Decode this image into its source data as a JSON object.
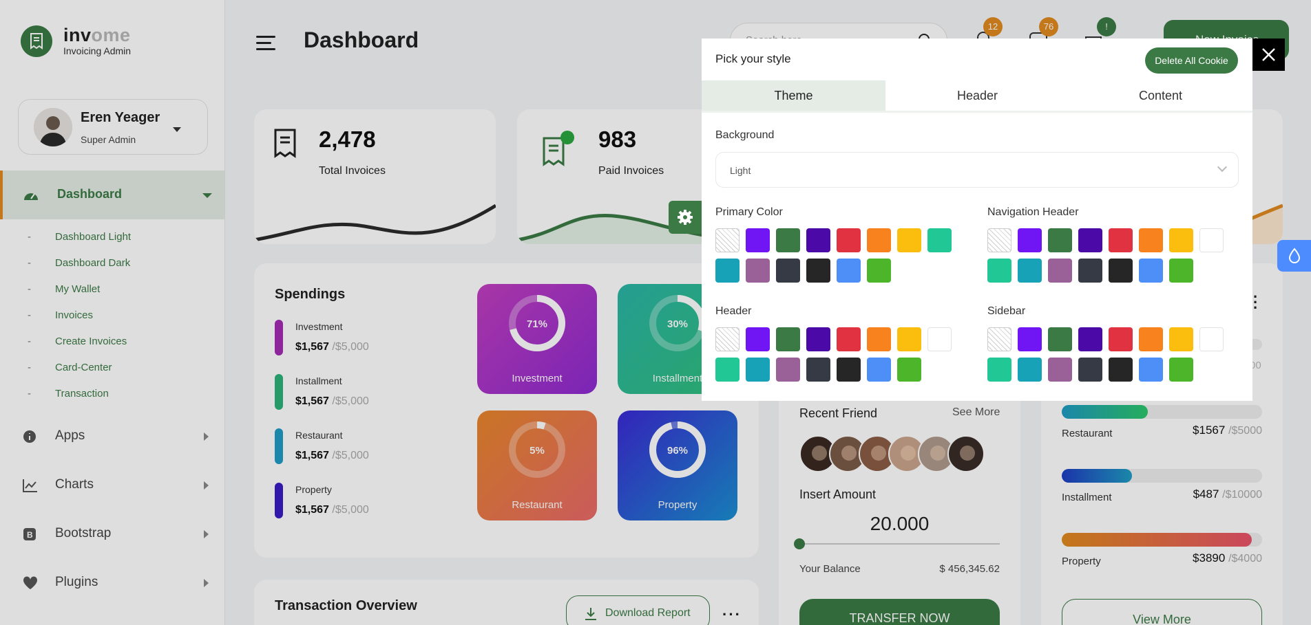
{
  "app": {
    "brand_dark": "inv",
    "brand_light": "ome",
    "subtitle": "Invoicing Admin"
  },
  "profile": {
    "name": "Eren Yeager",
    "role": "Super Admin"
  },
  "sidebar": {
    "active": "Dashboard",
    "sub_items": [
      "Dashboard Light",
      "Dashboard Dark",
      "My Wallet",
      "Invoices",
      "Create Invoices",
      "Card-Center",
      "Transaction"
    ],
    "items": [
      {
        "label": "Apps",
        "icon": "info-icon"
      },
      {
        "label": "Charts",
        "icon": "chart-icon"
      },
      {
        "label": "Bootstrap",
        "icon": "bootstrap-icon"
      },
      {
        "label": "Plugins",
        "icon": "heart-icon"
      }
    ]
  },
  "header": {
    "title": "Dashboard",
    "search_placeholder": "Search here...",
    "badges": [
      "12",
      "76",
      "!"
    ],
    "new_button": "New Invoice"
  },
  "stats": [
    {
      "value": "2,478",
      "label": "Total Invoices"
    },
    {
      "value": "983",
      "label": "Paid Invoices"
    }
  ],
  "spendings": {
    "title": "Spendings",
    "items": [
      {
        "name": "Investment",
        "value": "$1,567",
        "of": "/$5,000",
        "color": "#a42bb5"
      },
      {
        "name": "Installment",
        "value": "$1,567",
        "of": "/$5,000",
        "color": "#2cb37a"
      },
      {
        "name": "Restaurant",
        "value": "$1,567",
        "of": "/$5,000",
        "color": "#1f9cc4"
      },
      {
        "name": "Property",
        "value": "$1,567",
        "of": "/$5,000",
        "color": "#3a1cc4"
      }
    ],
    "tiles": [
      {
        "label": "Investment",
        "pct": "71%",
        "value": 71
      },
      {
        "label": "Installment",
        "pct": "30%",
        "value": 30
      },
      {
        "label": "Restaurant",
        "pct": "5%",
        "value": 5
      },
      {
        "label": "Property",
        "pct": "96%",
        "value": 96
      }
    ]
  },
  "transaction": {
    "title": "Transaction Overview",
    "download": "Download Report"
  },
  "wallet": {
    "recent_friend": "Recent Friend",
    "see_more": "See More",
    "insert_amount": "Insert Amount",
    "amount": "20.000",
    "balance_label": "Your Balance",
    "balance": "$ 456,345.62",
    "transfer": "TRANSFER NOW"
  },
  "budgets": {
    "items": [
      {
        "label": "Restaurant",
        "value": "$1567",
        "of": "/$5000",
        "fill": 0.43
      },
      {
        "label": "Installment",
        "value": "$487",
        "of": "/$10000",
        "fill": 0.35
      },
      {
        "label": "Property",
        "value": "$3890",
        "of": "/$4000",
        "fill": 0.95
      }
    ],
    "view_more": "View More",
    "partial_value": "00"
  },
  "style_panel": {
    "title": "Pick your style",
    "delete_cookie": "Delete All Cookie",
    "tabs": [
      "Theme",
      "Header",
      "Content"
    ],
    "background_label": "Background",
    "background_value": "Light",
    "primary_color_label": "Primary Color",
    "nav_header_label": "Navigation Header",
    "header_label": "Header",
    "sidebar_label": "Sidebar",
    "primary_swatches": [
      "none",
      "#7016f5",
      "#3b7a45",
      "#4b0aa8",
      "#e03241",
      "#f8831e",
      "#fbbd0e",
      "#21c896",
      "#17a2b8",
      "#9a6198",
      "#353a44",
      "#262626",
      "#4e8ef7",
      "#4db52a"
    ],
    "nav_swatches": [
      "none",
      "#7016f5",
      "#3b7a45",
      "#4b0aa8",
      "#e03241",
      "#f8831e",
      "#fbbd0e",
      "#ffffff",
      "#21c896",
      "#17a2b8",
      "#9a6198",
      "#353a44",
      "#262626",
      "#4e8ef7",
      "#4db52a"
    ],
    "header_swatches": [
      "none",
      "#7016f5",
      "#3b7a45",
      "#4b0aa8",
      "#e03241",
      "#f8831e",
      "#fbbd0e",
      "#ffffff",
      "#21c896",
      "#17a2b8",
      "#9a6198",
      "#353a44",
      "#262626",
      "#4e8ef7",
      "#4db52a"
    ],
    "sidebar_swatches": [
      "none",
      "#7016f5",
      "#3b7a45",
      "#4b0aa8",
      "#e03241",
      "#f8831e",
      "#fbbd0e",
      "#ffffff",
      "#21c896",
      "#17a2b8",
      "#9a6198",
      "#353a44",
      "#262626",
      "#4e8ef7",
      "#4db52a"
    ]
  },
  "colors": {
    "primary": "#3b7a45",
    "accent": "#e08a1f",
    "badge": "#e08a1f"
  }
}
